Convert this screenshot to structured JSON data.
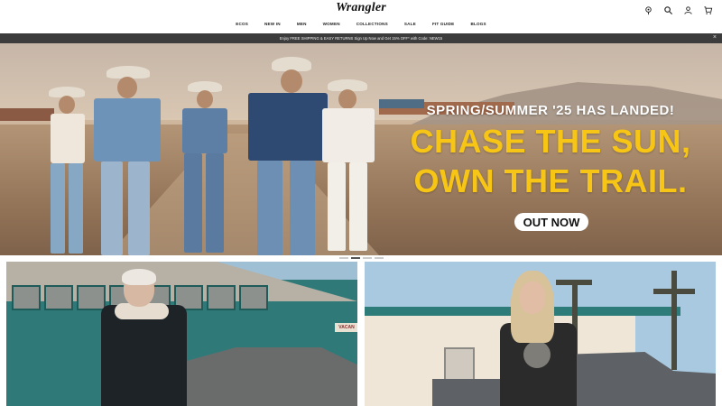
{
  "header": {
    "logo": "Wrangler",
    "nav": [
      "ECOS",
      "NEW IN",
      "MEN",
      "WOMEN",
      "COLLECTIONS",
      "SALE",
      "FIT GUIDE",
      "BLOGS"
    ],
    "icons": [
      "location-icon",
      "search-icon",
      "account-icon",
      "cart-icon"
    ]
  },
  "promo": {
    "text": "Enjoy FREE SHIPPING & EASY RETURNS Sign Up Now and Get 15% OFF* with Code: NEW15",
    "close": "×"
  },
  "hero": {
    "subtitle": "SPRING/SUMMER '25 HAS LANDED!",
    "title_line1": "CHASE THE SUN,",
    "title_line2": "OWN THE TRAIL.",
    "cta": "OUT NOW",
    "accent_color": "#f6c516"
  },
  "carousel": {
    "slides": 4,
    "active": 2
  },
  "tiles": {
    "left_sign": "VACAN"
  }
}
